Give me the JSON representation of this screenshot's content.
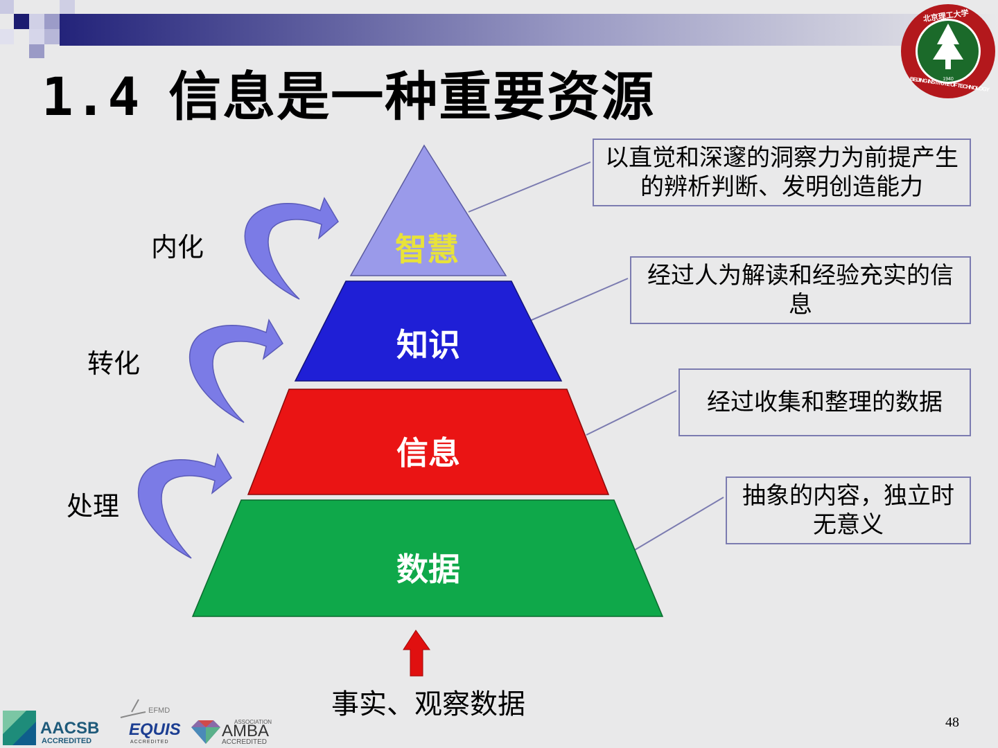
{
  "slide": {
    "number_label": "1.4",
    "title": "信息是一种重要资源",
    "page_number": "48"
  },
  "pyramid": {
    "levels": [
      {
        "label": "智慧",
        "color": "#9a9aea",
        "text_color": "#e8e23a"
      },
      {
        "label": "知识",
        "color": "#1f1fd6",
        "text_color": "#ffffff"
      },
      {
        "label": "信息",
        "color": "#ea1414",
        "text_color": "#ffffff"
      },
      {
        "label": "数据",
        "color": "#0fa84a",
        "text_color": "#ffffff"
      }
    ],
    "descriptions": [
      "以直觉和深邃的洞察力为前提产生的辨析判断、发明创造能力",
      "经过人为解读和经验充实的信息",
      "经过收集和整理的数据",
      "抽象的内容，独立时无意义"
    ],
    "transitions": [
      "内化",
      "转化",
      "处理"
    ],
    "input_label": "事实、观察数据"
  },
  "logos": {
    "university_top": "北京理工大学",
    "university_ring": "BEIJING INSTITUTE OF TECHNOLOGY",
    "university_year": "1940",
    "aacsb": "AACSB",
    "aacsb_sub": "ACCREDITED",
    "efmd": "EFMD",
    "equis": "EQUIS",
    "equis_sub": "ACCREDITED",
    "amba_assoc": "ASSOCIATION",
    "amba": "AMBA",
    "amba_sub": "ACCREDITED"
  },
  "colors": {
    "header_bar": "#2a2a80",
    "arrow": "#7b7be6",
    "box_border": "#7b7bb0",
    "up_arrow": "#e01010"
  }
}
